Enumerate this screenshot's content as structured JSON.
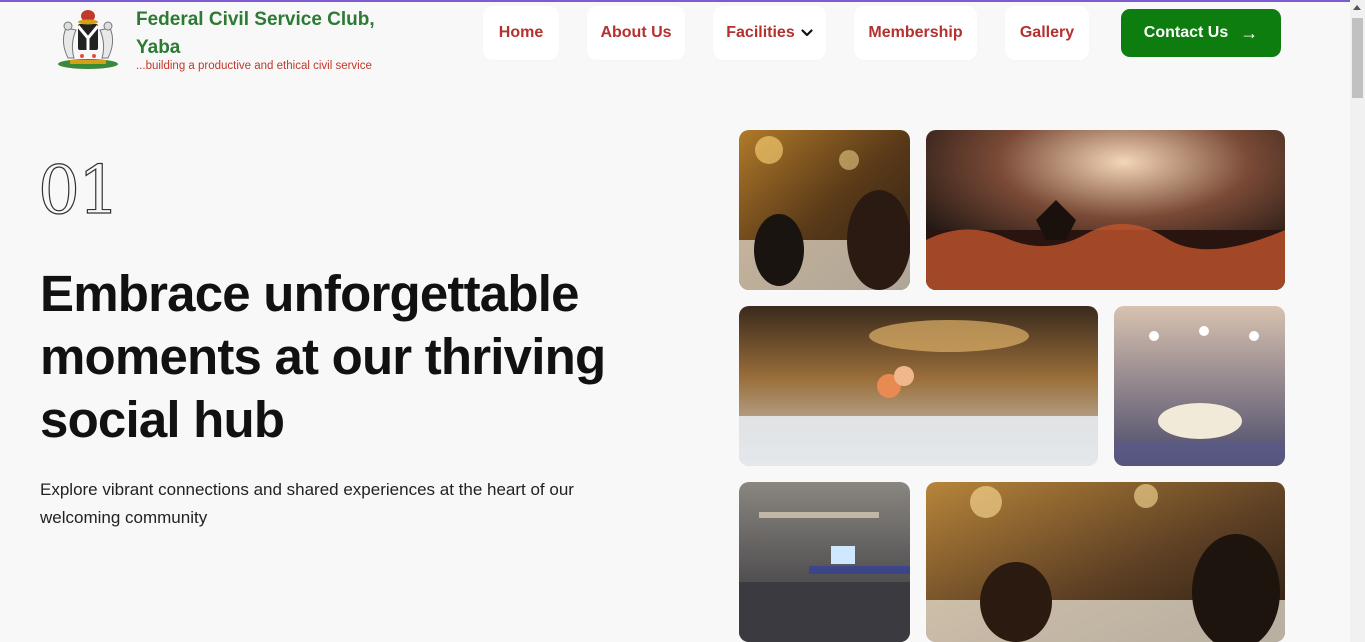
{
  "header": {
    "title": "Federal Civil Service Club, Yaba",
    "tagline": "...building a productive and ethical civil service"
  },
  "nav": {
    "home": "Home",
    "about": "About Us",
    "facilities": "Facilities",
    "membership": "Membership",
    "gallery": "Gallery",
    "contact": "Contact Us",
    "contact_arrow": "→"
  },
  "hero": {
    "number": "01",
    "headline": "Embrace unforgettable moments at our thriving social hub",
    "subtext": "Explore vibrant connections and shared experiences at the heart of our welcoming community"
  },
  "colors": {
    "brand_green": "#2d7a34",
    "nav_red": "#b3312e",
    "button_green": "#0e7d10"
  }
}
